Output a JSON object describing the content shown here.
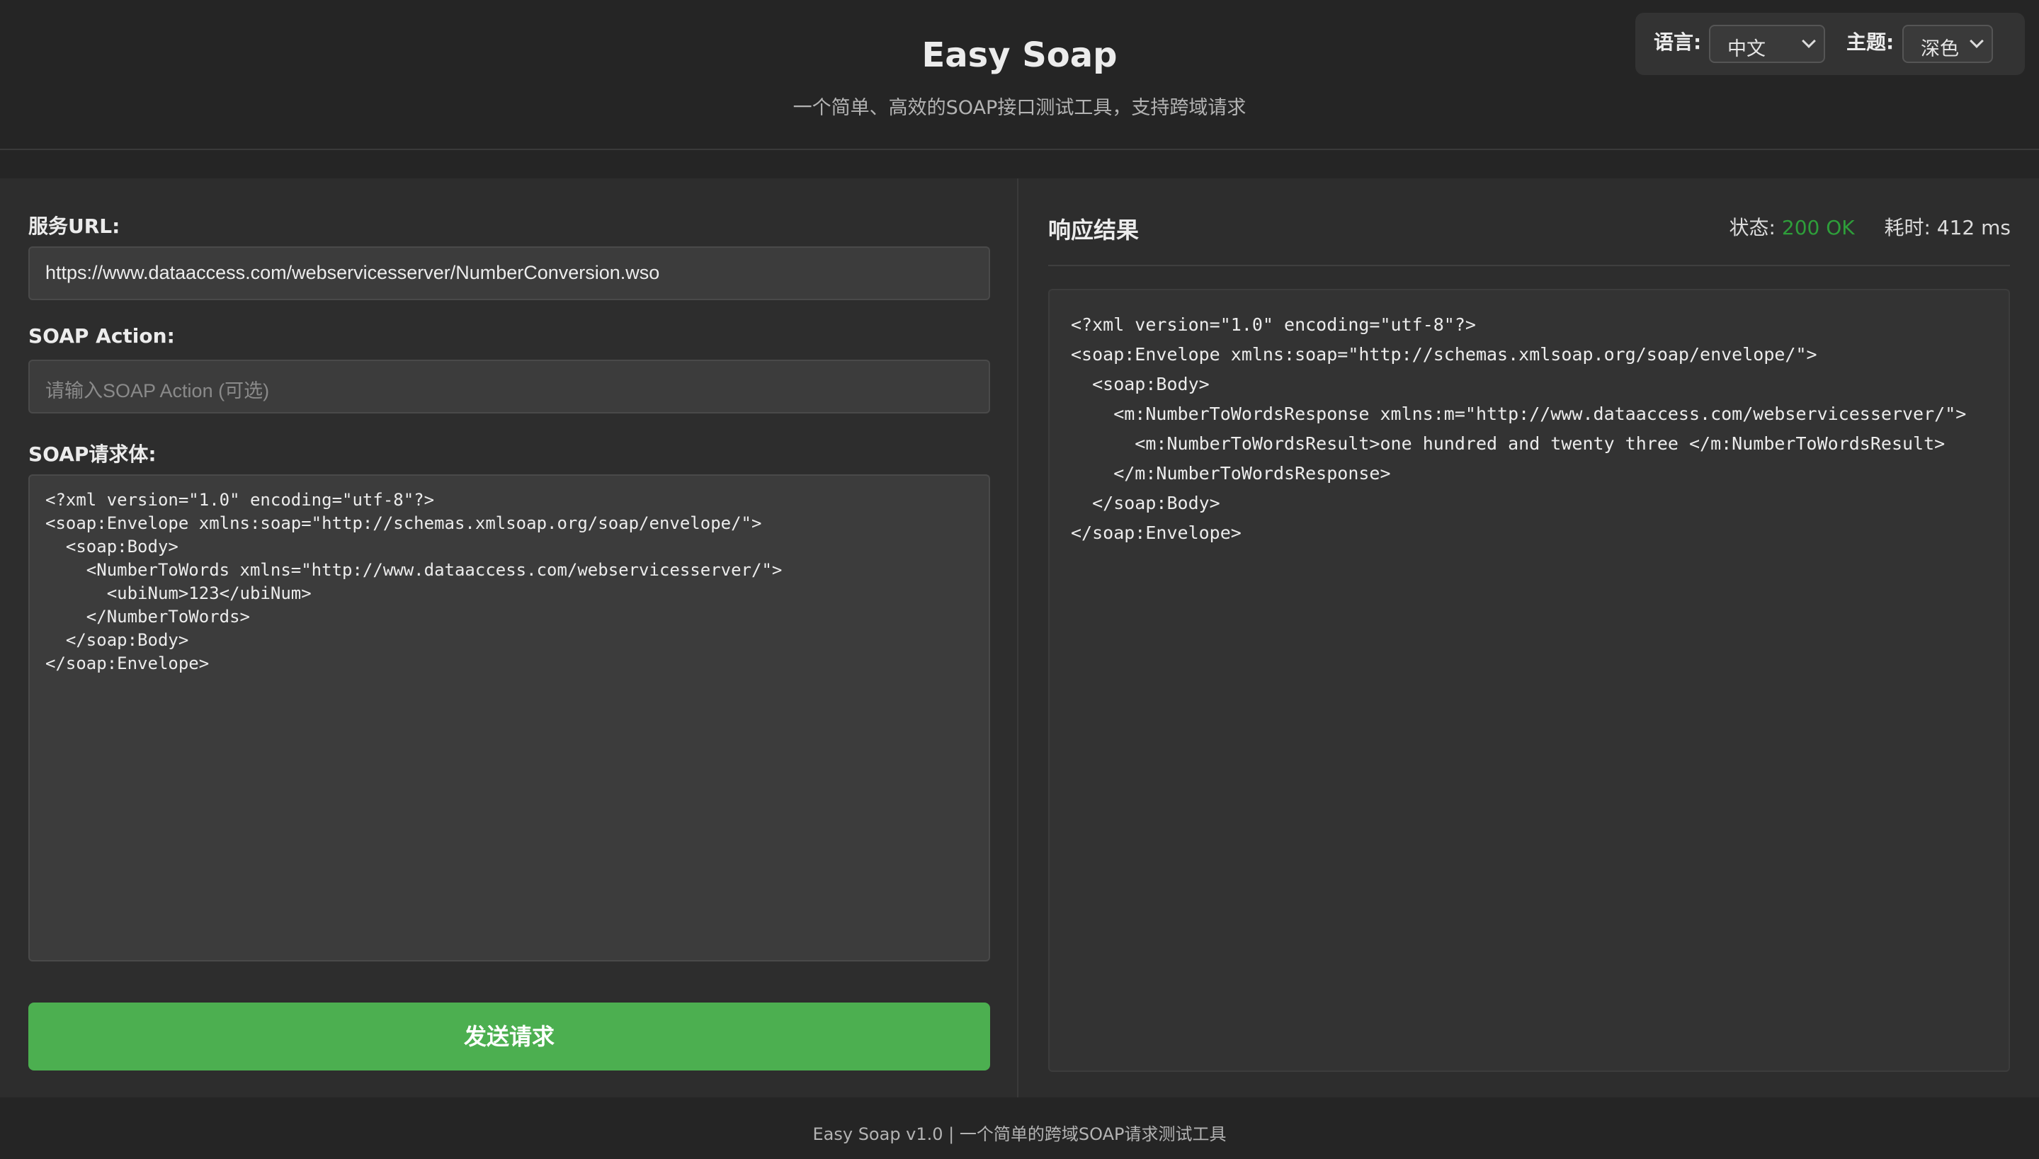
{
  "header": {
    "title": "Easy Soap",
    "subtitle": "一个简单、高效的SOAP接口测试工具，支持跨域请求"
  },
  "settings": {
    "language_label": "语言:",
    "language_value": "中文",
    "theme_label": "主题:",
    "theme_value": "深色"
  },
  "request": {
    "url_label": "服务URL:",
    "url_value": "https://www.dataaccess.com/webservicesserver/NumberConversion.wso",
    "action_label": "SOAP Action:",
    "action_placeholder": "请输入SOAP Action (可选)",
    "body_label": "SOAP请求体:",
    "body_value": "<?xml version=\"1.0\" encoding=\"utf-8\"?>\n<soap:Envelope xmlns:soap=\"http://schemas.xmlsoap.org/soap/envelope/\">\n  <soap:Body>\n    <NumberToWords xmlns=\"http://www.dataaccess.com/webservicesserver/\">\n      <ubiNum>123</ubiNum>\n    </NumberToWords>\n  </soap:Body>\n</soap:Envelope>",
    "send_label": "发送请求"
  },
  "response": {
    "title": "响应结果",
    "status_label": "状态:",
    "status_value": "200 OK",
    "time_label": "耗时:",
    "time_value": "412 ms",
    "body": "<?xml version=\"1.0\" encoding=\"utf-8\"?>\n<soap:Envelope xmlns:soap=\"http://schemas.xmlsoap.org/soap/envelope/\">\n  <soap:Body>\n    <m:NumberToWordsResponse xmlns:m=\"http://www.dataaccess.com/webservicesserver/\">\n      <m:NumberToWordsResult>one hundred and twenty three </m:NumberToWordsResult>\n    </m:NumberToWordsResponse>\n  </soap:Body>\n</soap:Envelope>"
  },
  "footer": {
    "text": "Easy Soap v1.0 | 一个简单的跨域SOAP请求测试工具"
  },
  "colors": {
    "background": "#252525",
    "panel": "#2d2d2d",
    "accent": "#4caf50",
    "status_ok": "#2e9e3a"
  }
}
